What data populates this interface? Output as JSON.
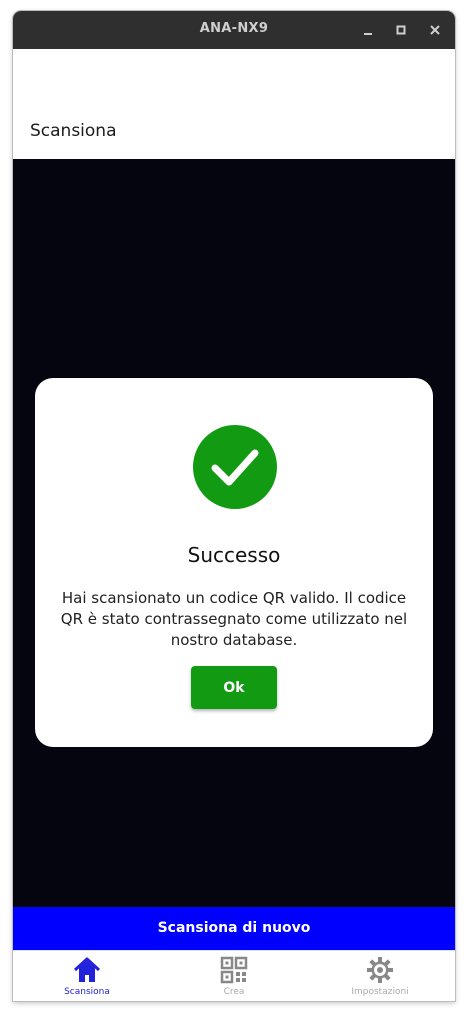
{
  "window": {
    "title": "ANA-NX9"
  },
  "appbar": {
    "title": "Scansiona"
  },
  "dialog": {
    "title": "Successo",
    "message": "Hai scansionato un codice QR valido. Il codice QR è stato contrassegnato come utilizzato nel nostro database.",
    "ok_label": "Ok",
    "icon": "check-circle-icon",
    "icon_color": "#139a13"
  },
  "rescan_button": {
    "label": "Scansiona di nuovo",
    "color": "#0000ff"
  },
  "navbar": {
    "items": [
      {
        "label": "Scansiona",
        "icon": "home-icon",
        "active": true
      },
      {
        "label": "Crea",
        "icon": "qr-code-icon",
        "active": false
      },
      {
        "label": "Impostazioni",
        "icon": "gear-icon",
        "active": false
      }
    ]
  }
}
